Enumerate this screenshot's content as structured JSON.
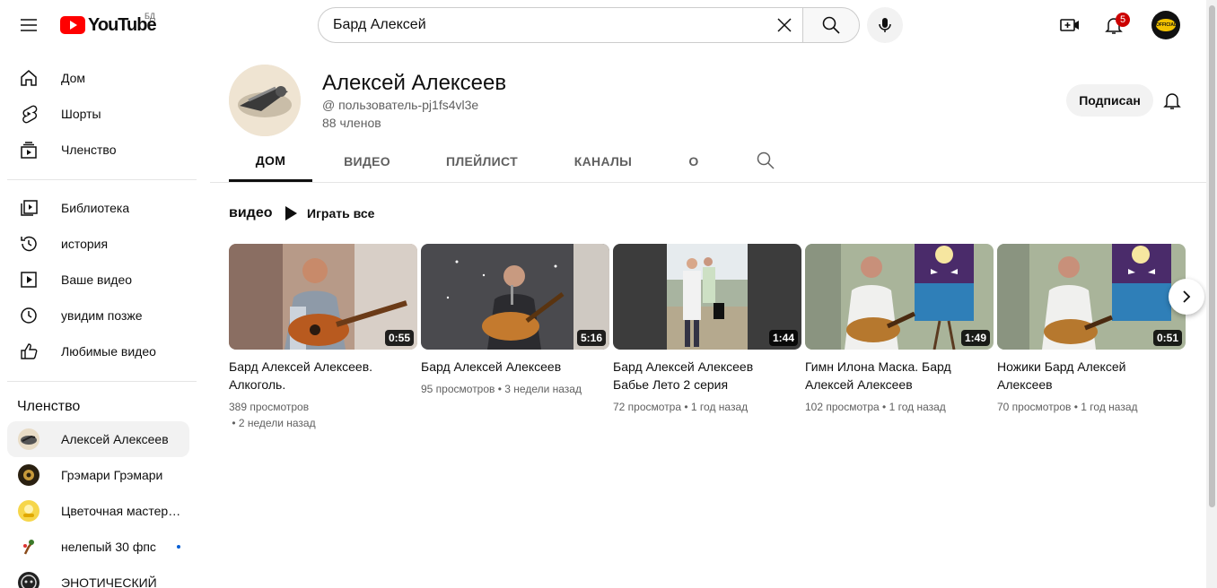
{
  "header": {
    "logo_text": "YouTube",
    "country_code": "БД",
    "search_value": "Бард Алексей",
    "notifications_count": "5",
    "avatar_text": "OFFICIAL"
  },
  "sidebar": {
    "main": [
      {
        "label": "Дом",
        "icon": "home-icon"
      },
      {
        "label": "Шорты",
        "icon": "shorts-icon"
      },
      {
        "label": "Членство",
        "icon": "subscriptions-icon"
      }
    ],
    "library": [
      {
        "label": "Библиотека",
        "icon": "library-icon"
      },
      {
        "label": "история",
        "icon": "history-icon"
      },
      {
        "label": "Ваше видео",
        "icon": "your-videos-icon"
      },
      {
        "label": "увидим позже",
        "icon": "watch-later-icon"
      },
      {
        "label": "Любимые видео",
        "icon": "liked-icon"
      }
    ],
    "subs_heading": "Членство",
    "subscriptions": [
      {
        "label": "Алексей Алексеев",
        "active": true
      },
      {
        "label": "Грэмари Грэмари"
      },
      {
        "label": "Цветочная мастерская"
      },
      {
        "label": "нелепый 30 фпс",
        "new": true
      },
      {
        "label": "ЭНОТИЧЕСКИЙ"
      }
    ]
  },
  "channel": {
    "name": "Алексей Алексеев",
    "handle": "@ пользователь-pj1fs4vl3e",
    "members": "88 членов",
    "subscribe_label": "Подписан"
  },
  "tabs": [
    "ДОМ",
    "ВИДЕО",
    "ПЛЕЙЛИСТ",
    "КАНАЛЫ",
    "О"
  ],
  "section": {
    "title": "видео",
    "play_all": "Играть все"
  },
  "videos": [
    {
      "title": "Бард Алексей Алексеев. Алкоголь.",
      "views": "389 просмотров",
      "age": "2 недели назад",
      "duration": "0:55"
    },
    {
      "title": "Бард Алексей Алексеев",
      "views": "95 просмотров",
      "age": "3 недели назад",
      "duration": "5:16"
    },
    {
      "title": "Бард Алексей Алексеев Бабье Лето 2 серия",
      "views": "72 просмотра",
      "age": "1 год назад",
      "duration": "1:44"
    },
    {
      "title": "Гимн Илона Маска. Бард Алексей Алексеев",
      "views": "102 просмотра",
      "age": "1 год назад",
      "duration": "1:49"
    },
    {
      "title": "Ножики Бард Алексей Алексеев",
      "views": "70 просмотров",
      "age": "1 год назад",
      "duration": "0:51"
    }
  ]
}
